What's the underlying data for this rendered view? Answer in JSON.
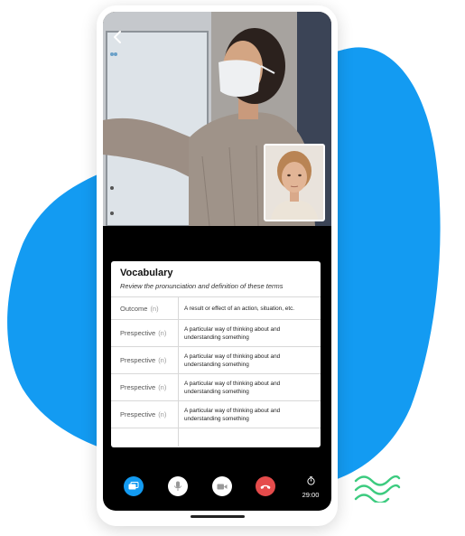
{
  "colors": {
    "brand_blue": "#139bf2",
    "light_blue": "#dff0fd",
    "accent_green": "#3ccb7f",
    "end_call_red": "#e54b4b"
  },
  "vocabulary": {
    "title": "Vocabulary",
    "subtitle": "Review the pronunciation and definition of these terms",
    "rows": [
      {
        "term": "Outcome",
        "pos": "(n)",
        "definition": "A result or effect of an action, situation, etc."
      },
      {
        "term": "Prespective",
        "pos": "(n)",
        "definition": "A particular way of thinking about and understanding something"
      },
      {
        "term": "Prespective",
        "pos": "(n)",
        "definition": "A particular way of thinking about and understanding something"
      },
      {
        "term": "Prespective",
        "pos": "(n)",
        "definition": "A particular way of thinking about and understanding something"
      },
      {
        "term": "Prespective",
        "pos": "(n)",
        "definition": "A particular way of thinking about and understanding something"
      }
    ]
  },
  "controls": {
    "icons": [
      "chat-icon",
      "microphone-icon",
      "video-camera-icon",
      "end-call-icon",
      "timer-icon"
    ],
    "timer": "29:00"
  },
  "icons": {
    "back": "chevron-left-icon"
  }
}
